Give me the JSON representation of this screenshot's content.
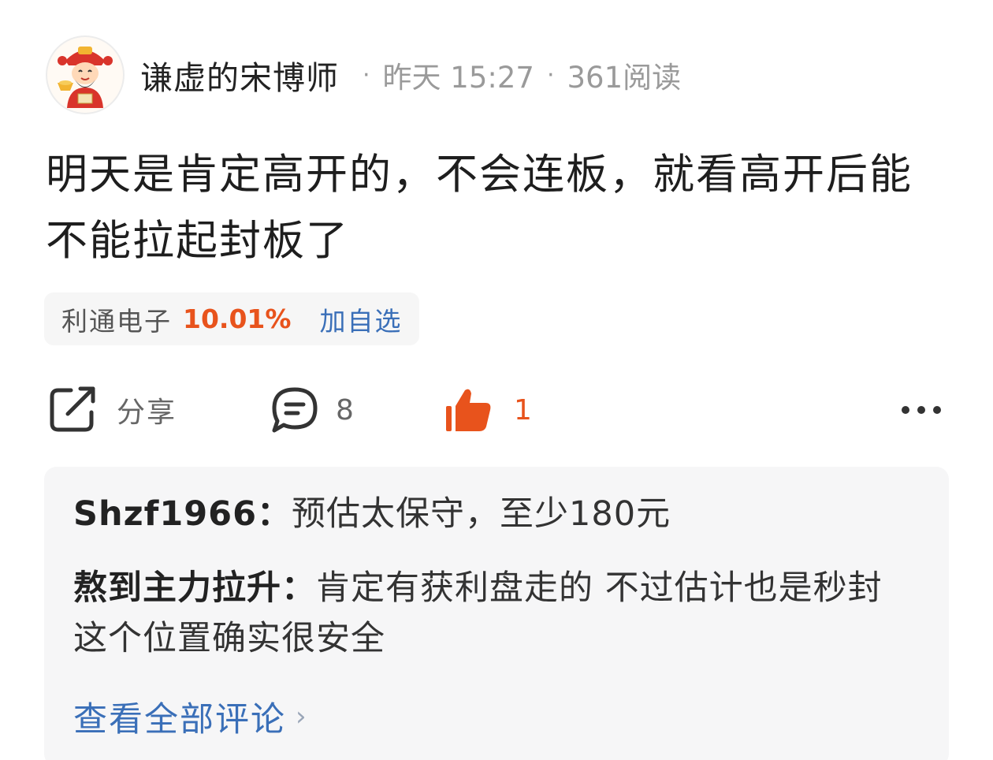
{
  "post": {
    "author": "谦虚的宋博师",
    "time": "昨天 15:27",
    "reads": "361阅读",
    "separator": "·",
    "text": "明天是肯定高开的，不会连板，就看高开后能不能拉起封板了"
  },
  "stock": {
    "name": "利通电子",
    "change": "10.01%",
    "add_label": "加自选"
  },
  "actions": {
    "share_label": "分享",
    "comment_count": "8",
    "like_count": "1"
  },
  "comments": {
    "items": [
      {
        "user": "Shzf1966：",
        "text": "预估太保守，至少180元"
      },
      {
        "user": "熬到主力拉升：",
        "text": "肯定有获利盘走的 不过估计也是秒封 这个位置确实很安全"
      }
    ],
    "view_all": "查看全部评论"
  },
  "colors": {
    "accent_orange": "#e8531c",
    "link_blue": "#3a6fb8",
    "muted_gray": "#9a9a9a"
  },
  "icons": [
    "avatar-god-of-wealth",
    "share-icon",
    "comment-icon",
    "thumbs-up-icon",
    "more-icon",
    "chevron-right-icon"
  ]
}
